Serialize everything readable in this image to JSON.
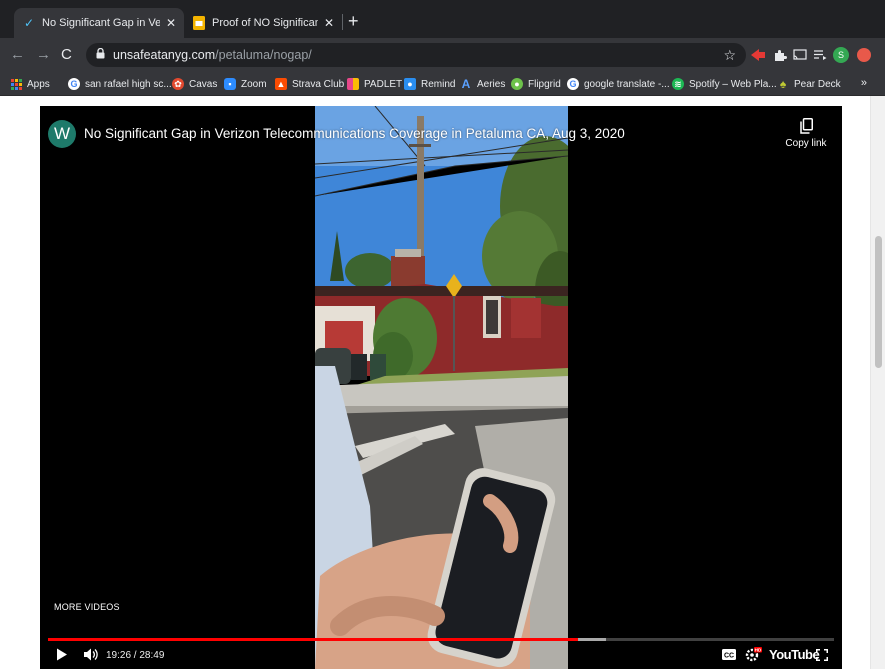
{
  "browser": {
    "tabs": [
      {
        "title": "No Significant Gap in Verizon T",
        "icon": "checkmark-favicon",
        "active": true
      },
      {
        "title": "Proof of NO Significant Gap of",
        "icon": "slides-favicon",
        "active": false
      }
    ],
    "url_host": "unsafeatanyg.com",
    "url_path": "/petaluma/nogap/",
    "bookmarks": [
      {
        "label": "Apps",
        "icon": "apps-grid-icon",
        "color": "#4285f4"
      },
      {
        "label": "san rafael high sc...",
        "icon": "google-icon",
        "color": "#4285f4"
      },
      {
        "label": "Cavas",
        "icon": "cavas-icon",
        "color": "#e2492f"
      },
      {
        "label": "Zoom",
        "icon": "zoom-icon",
        "color": "#2d8cff"
      },
      {
        "label": "Strava Club",
        "icon": "strava-icon",
        "color": "#fc4c02"
      },
      {
        "label": "PADLET",
        "icon": "padlet-icon",
        "color": "#e8488a"
      },
      {
        "label": "Remind",
        "icon": "remind-icon",
        "color": "#2a8ef0"
      },
      {
        "label": "Aeries",
        "icon": "aeries-icon",
        "color": "#1f62c4"
      },
      {
        "label": "Flipgrid",
        "icon": "flipgrid-icon",
        "color": "#6dc24b"
      },
      {
        "label": "google translate -...",
        "icon": "google-icon",
        "color": "#4285f4"
      },
      {
        "label": "Spotify – Web Pla...",
        "icon": "spotify-icon",
        "color": "#1db954"
      },
      {
        "label": "Pear Deck",
        "icon": "pear-deck-icon",
        "color": "#8bc34a"
      }
    ],
    "bookmarks_overflow": "»",
    "new_tab_symbol": "+",
    "profile_initial": "S"
  },
  "video": {
    "channel_initial": "W",
    "title": "No Significant Gap in Verizon Telecommunications Coverage in Petaluma CA, Aug 3, 2020",
    "copy_link_label": "Copy link",
    "more_videos_label": "MORE VIDEOS",
    "current_time": "19:26",
    "duration": "28:49",
    "time_display": "19:26 / 28:49",
    "played_fraction": 0.674,
    "buffered_fraction": 0.71,
    "brand": "YouTube",
    "colors": {
      "progress": "#ff0000",
      "avatar": "#1e7a6a"
    }
  }
}
